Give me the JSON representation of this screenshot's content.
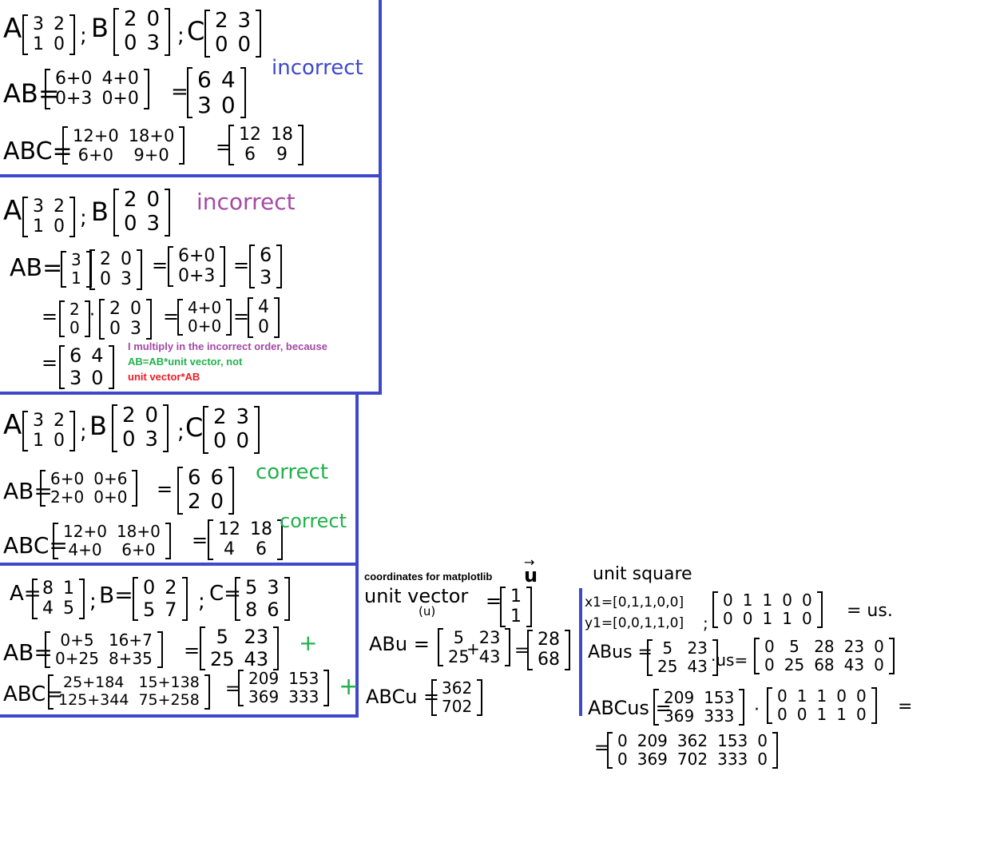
{
  "colors": {
    "frame": "#3f48cc",
    "blue_label": "#3f48cc",
    "purple_label": "#a349a4",
    "green_label": "#22b14c",
    "red_text": "#ed1c24"
  },
  "p1": {
    "lab_a": "A",
    "mat_a": [
      [
        "3",
        "2"
      ],
      [
        "1",
        "0"
      ]
    ],
    "sep1": ";",
    "lab_b": "B",
    "mat_b": [
      [
        "2",
        "0"
      ],
      [
        "0",
        "3"
      ]
    ],
    "sep2": ";",
    "lab_c": "C",
    "mat_c": [
      [
        "2",
        "3"
      ],
      [
        "0",
        "0"
      ]
    ],
    "ab_lhs": "AB=",
    "ab_m1": [
      [
        "6+0",
        "4+0"
      ],
      [
        "0+3",
        "0+0"
      ]
    ],
    "ab_eq": "=",
    "ab_m2": [
      [
        "6",
        "4"
      ],
      [
        "3",
        "0"
      ]
    ],
    "verdict": "incorrect",
    "abc_lhs": "ABC=",
    "abc_m1": [
      [
        "12+0",
        "18+0"
      ],
      [
        "6+0",
        "9+0"
      ]
    ],
    "abc_eq": "=",
    "abc_m2": [
      [
        "12",
        "18"
      ],
      [
        "6",
        "9"
      ]
    ]
  },
  "p2": {
    "lab_a": "A",
    "mat_a": [
      [
        "3",
        "2"
      ],
      [
        "1",
        "0"
      ]
    ],
    "sep1": ";",
    "lab_b": "B",
    "mat_b": [
      [
        "2",
        "0"
      ],
      [
        "0",
        "3"
      ]
    ],
    "verdict": "incorrect",
    "ab_lhs": "AB=",
    "v1": [
      [
        "3"
      ],
      [
        "1"
      ]
    ],
    "b1": [
      [
        "2",
        "0"
      ],
      [
        "0",
        "3"
      ]
    ],
    "eq1": "=",
    "r1": [
      [
        "6+0"
      ],
      [
        "0+3"
      ]
    ],
    "eq2": "=",
    "r1b": [
      [
        "6"
      ],
      [
        "3"
      ]
    ],
    "eq3": "=",
    "v2": [
      [
        "2"
      ],
      [
        "0"
      ]
    ],
    "dot2": "·",
    "b2": [
      [
        "2",
        "0"
      ],
      [
        "0",
        "3"
      ]
    ],
    "eq4": "=",
    "r2": [
      [
        "4+0"
      ],
      [
        "0+0"
      ]
    ],
    "eq5": "=",
    "r2b": [
      [
        "4"
      ],
      [
        "0"
      ]
    ],
    "eq6": "=",
    "res": [
      [
        "6",
        "4"
      ],
      [
        "3",
        "0"
      ]
    ],
    "note1": "I multiply in the incorrect order, because",
    "note2": "AB=AB*unit vector, not",
    "note3": "unit vector*AB"
  },
  "p3": {
    "lab_a": "A",
    "mat_a": [
      [
        "3",
        "2"
      ],
      [
        "1",
        "0"
      ]
    ],
    "sep1": ";",
    "lab_b": "B",
    "mat_b": [
      [
        "2",
        "0"
      ],
      [
        "0",
        "3"
      ]
    ],
    "sep2": ";",
    "lab_c": "C",
    "mat_c": [
      [
        "2",
        "3"
      ],
      [
        "0",
        "0"
      ]
    ],
    "ab_lhs": "AB=",
    "ab_m1": [
      [
        "6+0",
        "0+6"
      ],
      [
        "2+0",
        "0+0"
      ]
    ],
    "ab_eq": "=",
    "ab_m2": [
      [
        "6",
        "6"
      ],
      [
        "2",
        "0"
      ]
    ],
    "verdict1": "correct",
    "abc_lhs": "ABC=",
    "abc_m1": [
      [
        "12+0",
        "18+0"
      ],
      [
        "4+0",
        "6+0"
      ]
    ],
    "abc_eq": "=",
    "abc_m2": [
      [
        "12",
        "18"
      ],
      [
        "4",
        "6"
      ]
    ],
    "verdict2": "correct"
  },
  "p4": {
    "lab_a": "A=",
    "mat_a": [
      [
        "8",
        "1"
      ],
      [
        "4",
        "5"
      ]
    ],
    "sep1": ";",
    "lab_b": "B=",
    "mat_b": [
      [
        "0",
        "2"
      ],
      [
        "5",
        "7"
      ]
    ],
    "sep2": ";",
    "lab_c": "C=",
    "mat_c": [
      [
        "5",
        "3"
      ],
      [
        "8",
        "6"
      ]
    ],
    "ab_lhs": "AB=",
    "ab_m1": [
      [
        "0+5",
        "16+7"
      ],
      [
        "0+25",
        "8+35"
      ]
    ],
    "ab_eq": "=",
    "ab_m2": [
      [
        "5",
        "23"
      ],
      [
        "25",
        "43"
      ]
    ],
    "plus1": "+",
    "abc_lhs": "ABC=",
    "abc_m1": [
      [
        "25+184",
        "15+138"
      ],
      [
        "125+344",
        "75+258"
      ]
    ],
    "abc_eq": "=",
    "abc_m2": [
      [
        "209",
        "153"
      ],
      [
        "369",
        "333"
      ]
    ],
    "plus2": "+"
  },
  "mid": {
    "coords_title": "coordinates for matplotlib",
    "u_symbol": "u",
    "uv_label": "unit vector",
    "uv_sub": "(u)",
    "uv_eq": "=",
    "uv_mat": [
      [
        "1"
      ],
      [
        "1"
      ]
    ],
    "abu_lhs": "ABu =",
    "abu_m1": [
      [
        "5",
        "23"
      ],
      [
        "25",
        "43"
      ]
    ],
    "abu_plus": "+",
    "abu_eq": "=",
    "abu_m2": [
      [
        "28"
      ],
      [
        "68"
      ]
    ],
    "abcu_lhs": "ABCu =",
    "abcu_m": [
      [
        "362"
      ],
      [
        "702"
      ]
    ]
  },
  "right": {
    "title": "unit square",
    "x1": "x1=[0,1,1,0,0]",
    "y1": "y1=[0,0,1,1,0]",
    "semi": ";",
    "us_mat": [
      [
        "0",
        "1",
        "1",
        "0",
        "0"
      ],
      [
        "0",
        "0",
        "1",
        "1",
        "0"
      ]
    ],
    "us_eq": "= us.",
    "abus_lhs": "ABus =",
    "abus_m1": [
      [
        "5",
        "23"
      ],
      [
        "25",
        "43"
      ]
    ],
    "abus_mid": "·us=",
    "abus_m2": [
      [
        "0",
        "5",
        "28",
        "23",
        "0"
      ],
      [
        "0",
        "25",
        "68",
        "43",
        "0"
      ]
    ],
    "abcus_lhs": "ABCus =",
    "abcus_m1": [
      [
        "209",
        "153"
      ],
      [
        "369",
        "333"
      ]
    ],
    "abcus_dot": "·",
    "abcus_m2": [
      [
        "0",
        "1",
        "1",
        "0",
        "0"
      ],
      [
        "0",
        "0",
        "1",
        "1",
        "0"
      ]
    ],
    "abcus_eq": "=",
    "final_eq": "=",
    "final_m": [
      [
        "0",
        "209",
        "362",
        "153",
        "0"
      ],
      [
        "0",
        "369",
        "702",
        "333",
        "0"
      ]
    ]
  }
}
